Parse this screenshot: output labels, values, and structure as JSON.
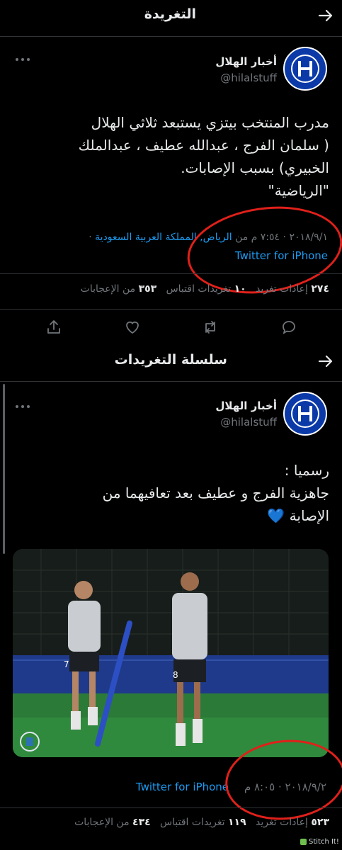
{
  "header1": {
    "title": "التغريدة"
  },
  "tweet": {
    "author_name": "أخبار الهلال",
    "handle": "@hilalstuff",
    "avatar_text": "HILALSTUFF",
    "text_lines": [
      "مدرب المنتخب بيتزي يستبعد ثلاثي الهلال",
      "( سلمان الفرج ، عبدالله عطيف ، عبدالملك",
      "الخبيري) بسبب الإصابات.",
      "\"الرياضية\""
    ],
    "meta_time": "٢٠١٨/٩/١ · ٧:٥٤ م من",
    "meta_location": "الرياض, المملكة العربية السعودية",
    "meta_sep": "·",
    "client": "Twitter for iPhone",
    "retweets_count": "٢٧٤",
    "retweets_label": "إعادات تغريد",
    "quotes_count": "١٠",
    "quotes_label": "تغريدات اقتباس",
    "likes_count": "٣٥٣",
    "likes_label": "من الإعجابات"
  },
  "header2": {
    "title": "سلسلة التغريدات"
  },
  "thread": {
    "author_name": "أخبار الهلال",
    "handle": "@hilalstuff",
    "text_line1": "رسميا :",
    "text_line2": "جاهزية الفرج و عطيف بعد تعافيهما من",
    "text_line3": "الإصابة 💙",
    "meta_time": "٢٠١٨/٩/٢ · ٨:٠٥ م",
    "client": "Twitter for iPhone",
    "retweets_count": "٥٢٣",
    "retweets_label": "إعادات تغريد",
    "quotes_count": "١١٩",
    "quotes_label": "تغريدات اقتباس",
    "likes_count": "٤٣٤",
    "likes_label": "من الإعجابات",
    "player_left_number": "7",
    "player_right_number": "8"
  },
  "watermark": "Stitch It!",
  "colors": {
    "background": "#000000",
    "accent": "#1d9bf0",
    "muted": "#71767b",
    "annotation": "#e0201a"
  }
}
